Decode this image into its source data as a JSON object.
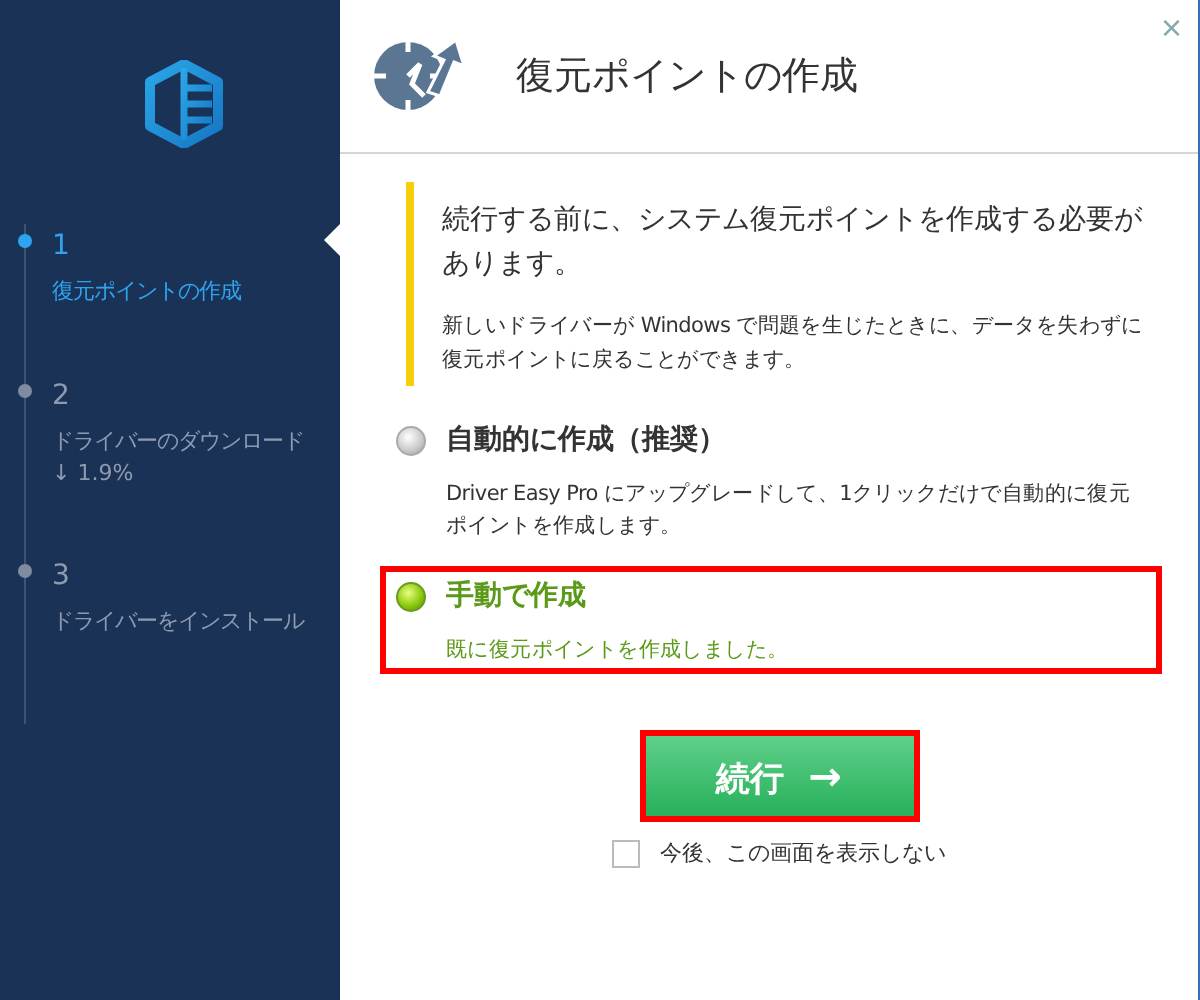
{
  "sidebar": {
    "steps": [
      {
        "number": "1",
        "label": "復元ポイントの作成",
        "selected": true
      },
      {
        "number": "2",
        "label": "ドライバーのダウンロード",
        "detail": "↓ 1.9%",
        "selected": false
      },
      {
        "number": "3",
        "label": "ドライバーをインストール",
        "selected": false
      }
    ]
  },
  "dialog": {
    "title": "復元ポイントの作成",
    "close": "×",
    "notice": {
      "heading": "続行する前に、システム復元ポイントを作成する必要があります。",
      "body": "新しいドライバーが Windows で問題を生じたときに、データを失わずに復元ポイントに戻ることができます。"
    },
    "options": [
      {
        "label": "自動的に作成（推奨）",
        "description": "Driver Easy Pro にアップグレードして、1クリックだけで自動的に復元ポイントを作成します。",
        "selected": false,
        "highlighted": false
      },
      {
        "label": "手動で作成",
        "description": "既に復元ポイントを作成しました。",
        "selected": true,
        "highlighted": true
      }
    ],
    "continue_button": {
      "label": "続行",
      "arrow": "→",
      "highlighted": true
    },
    "dont_show": {
      "label": "今後、この画面を表示しない",
      "checked": false
    }
  }
}
